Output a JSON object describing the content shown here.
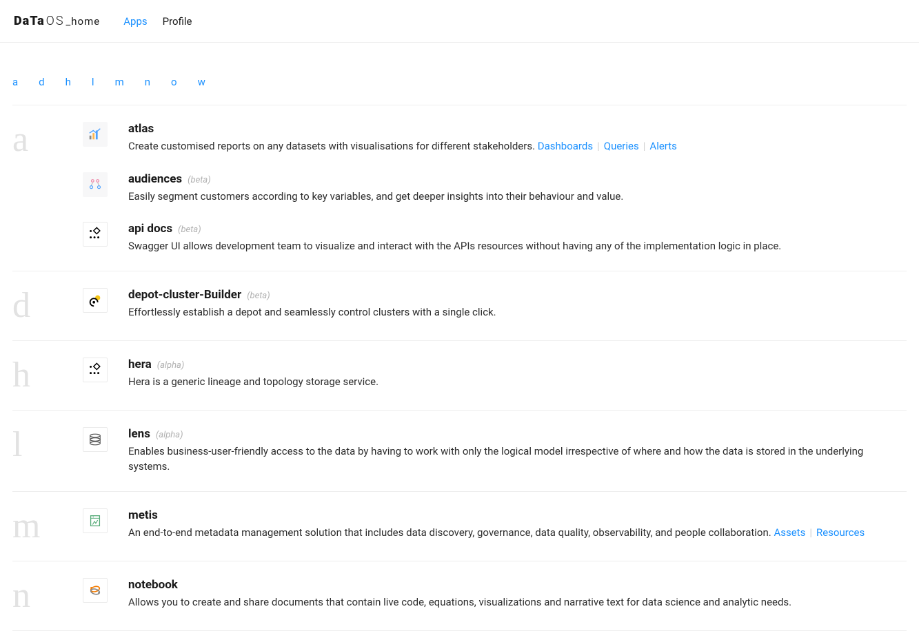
{
  "header": {
    "logo_bold": "DaTa",
    "logo_thin": "OS",
    "logo_home": "_home",
    "nav": [
      {
        "label": "Apps",
        "active": true
      },
      {
        "label": "Profile",
        "active": false
      }
    ]
  },
  "letter_nav": [
    "a",
    "d",
    "h",
    "l",
    "m",
    "n",
    "o",
    "w"
  ],
  "sections": [
    {
      "letter": "a",
      "apps": [
        {
          "icon": "atlas",
          "title": "atlas",
          "tag": "",
          "desc": "Create customised reports on any datasets with visualisations for different stakeholders.",
          "links": [
            "Dashboards",
            "Queries",
            "Alerts"
          ]
        },
        {
          "icon": "audiences",
          "title": "audiences",
          "tag": "(beta)",
          "desc": "Easily segment customers according to key variables, and get deeper insights into their behaviour and value.",
          "links": []
        },
        {
          "icon": "apidocs",
          "title": "api docs",
          "tag": "(beta)",
          "desc": "Swagger UI allows development team to visualize and interact with the APIs resources without having any of the implementation logic in place.",
          "links": []
        }
      ]
    },
    {
      "letter": "d",
      "apps": [
        {
          "icon": "depot",
          "title": "depot-cluster-Builder",
          "tag": "(beta)",
          "desc": "Effortlessly establish a depot and seamlessly control clusters with a single click.",
          "links": []
        }
      ]
    },
    {
      "letter": "h",
      "apps": [
        {
          "icon": "hera",
          "title": "hera",
          "tag": "(alpha)",
          "desc": "Hera is a generic lineage and topology storage service.",
          "links": []
        }
      ]
    },
    {
      "letter": "l",
      "apps": [
        {
          "icon": "lens",
          "title": "lens",
          "tag": "(alpha)",
          "desc": "Enables business-user-friendly access to the data by having to work with only the logical model irrespective of where and how the data is stored in the underlying systems.",
          "links": []
        }
      ]
    },
    {
      "letter": "m",
      "apps": [
        {
          "icon": "metis",
          "title": "metis",
          "tag": "",
          "desc": "An end-to-end metadata management solution that includes data discovery, governance, data quality, observability, and people collaboration.",
          "links": [
            "Assets",
            "Resources"
          ]
        }
      ]
    },
    {
      "letter": "n",
      "apps": [
        {
          "icon": "notebook",
          "title": "notebook",
          "tag": "",
          "desc": "Allows you to create and share documents that contain live code, equations, visualizations and narrative text for data science and analytic needs.",
          "links": []
        }
      ]
    }
  ]
}
